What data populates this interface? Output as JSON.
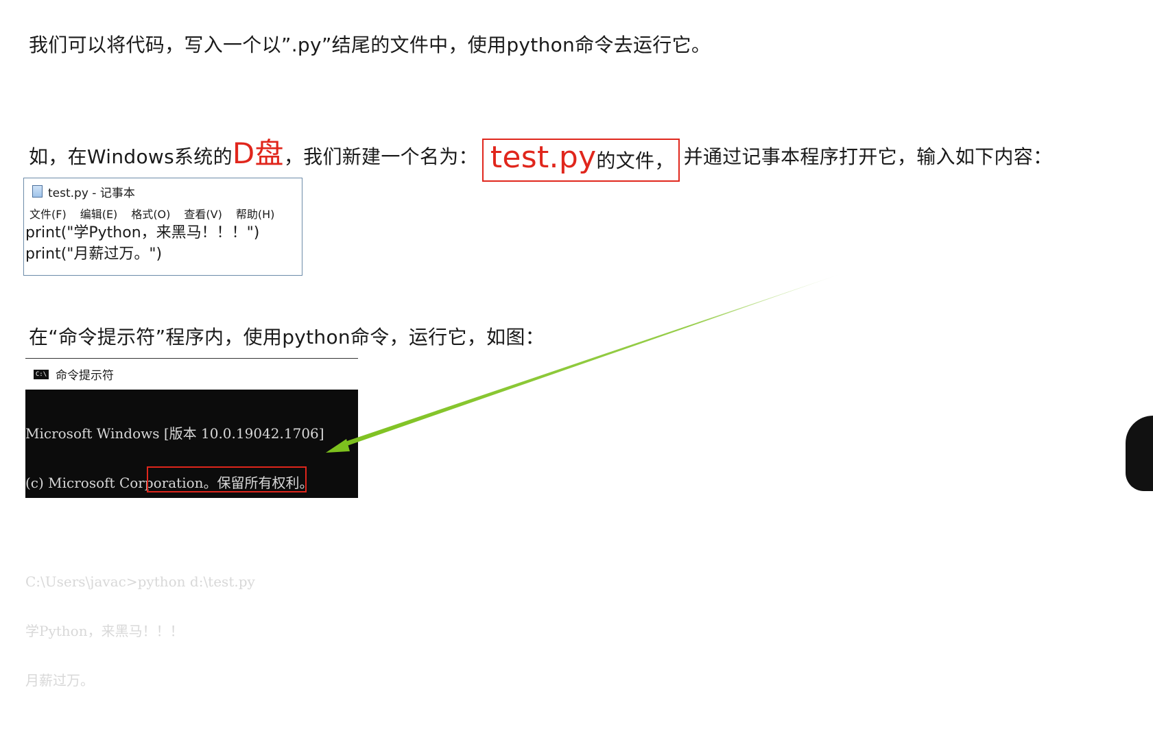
{
  "lines": {
    "intro": "我们可以将代码，写入一个以”.py”结尾的文件中，使用python命令去运行它。",
    "line2_a": "如，在Windows系统的",
    "line2_d": "D盘",
    "line2_b": "，我们新建一个名为：",
    "line2_file": "test.py",
    "line2_c": "的文件，",
    "line2_d2": "并通过记事本程序打开它，输入如下内容：",
    "cmd_caption": "在“命令提示符”程序内，使用python命令，运行它，如图："
  },
  "notepad": {
    "title": "test.py - 记事本",
    "menu": [
      "文件(F)",
      "编辑(E)",
      "格式(O)",
      "查看(V)",
      "帮助(H)"
    ],
    "lines": [
      "print(\"学Python，来黑马！！！\")",
      "print(\"月薪过万。\")"
    ]
  },
  "cmd": {
    "title": "命令提示符",
    "icon_text": "C:\\",
    "lines": [
      "Microsoft Windows [版本 10.0.19042.1706]",
      "(c) Microsoft Corporation。保留所有权利。",
      "",
      "C:\\Users\\javac>python d:\\test.py",
      "学Python，来黑马！！！",
      "月薪过万。"
    ]
  },
  "colors": {
    "accent_red": "#e0261c",
    "arrow_green": "#7dc11e"
  }
}
